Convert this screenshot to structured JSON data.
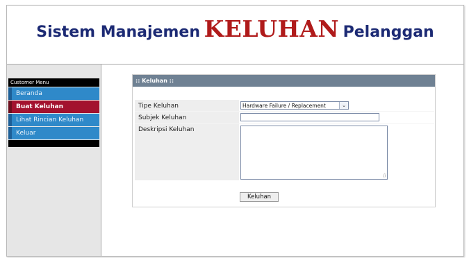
{
  "header": {
    "title_part1": "Sistem Manajemen",
    "title_emphasis": "KELUHAN",
    "title_part2": "Pelanggan"
  },
  "sidebar": {
    "menu_title": "Customer Menu",
    "items": [
      {
        "label": "Beranda",
        "active": false
      },
      {
        "label": "Buat Keluhan",
        "active": true
      },
      {
        "label": "Lihat Rincian Keluhan",
        "active": false
      },
      {
        "label": "Keluar",
        "active": false
      }
    ]
  },
  "panel": {
    "title": ":: Keluhan ::"
  },
  "form": {
    "tipe_label": "Tipe Keluhan",
    "tipe_selected": "Hardware Failure / Replacement",
    "subjek_label": "Subjek Keluhan",
    "subjek_value": "",
    "deskripsi_label": "Deskripsi Keluhan",
    "deskripsi_value": "",
    "submit_label": "Keluhan"
  },
  "colors": {
    "title_blue": "#1c2a74",
    "title_red": "#b01a1a",
    "menu_blue": "#2f89c9",
    "menu_active": "#a3122e",
    "panel_header": "#6f8193"
  },
  "icons": {
    "select_arrow": "chevron-down-icon",
    "resize_grip": "resize-grip-icon"
  }
}
